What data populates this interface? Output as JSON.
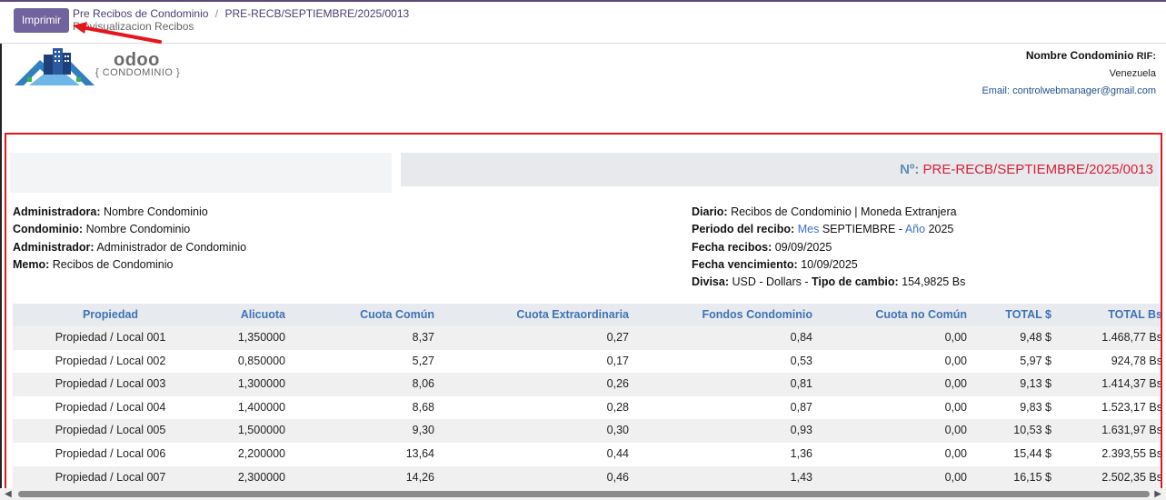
{
  "control_panel": {
    "print_label": "Imprimir",
    "breadcrumb_parent": "Pre Recibos de Condominio",
    "breadcrumb_separator": "/",
    "breadcrumb_current": "PRE-RECB/SEPTIEMBRE/2025/0013",
    "subtitle": "Previsualizacion Recibos"
  },
  "logo": {
    "brand": "odoo",
    "tagline": "{ CONDOMINIO }"
  },
  "company": {
    "name": "Nombre Condominio",
    "rif_label": "RIF:",
    "country": "Venezuela",
    "email": "Email: controlwebmanager@gmail.com"
  },
  "report": {
    "number_label": "Nº:",
    "number": "PRE-RECB/SEPTIEMBRE/2025/0013",
    "left_info": {
      "administradora_label": "Administradora:",
      "administradora": "Nombre Condominio",
      "condominio_label": "Condominio:",
      "condominio": "Nombre Condominio",
      "administrador_label": "Administrador:",
      "administrador": "Administrador de Condominio",
      "memo_label": "Memo:",
      "memo": "Recibos de Condominio"
    },
    "right_info": {
      "diario_label": "Diario:",
      "diario": "Recibos de Condominio | Moneda Extranjera",
      "periodo_label": "Periodo del recibo:",
      "mes_label": "Mes",
      "mes": "SEPTIEMBRE",
      "dash": "-",
      "anio_label": "Año",
      "anio": "2025",
      "fecha_recibos_label": "Fecha recibos:",
      "fecha_recibos": "09/09/2025",
      "fecha_venc_label": "Fecha vencimiento:",
      "fecha_venc": "10/09/2025",
      "divisa_label": "Divisa:",
      "divisa": "USD - Dollars -",
      "tipo_cambio_label": "Tipo de cambio:",
      "tipo_cambio": "154,9825 Bs"
    },
    "columns": [
      "Propiedad",
      "Alicuota",
      "Cuota Común",
      "Cuota Extraordinaria",
      "Fondos Condominio",
      "Cuota no Común",
      "TOTAL $",
      "TOTAL Bs"
    ],
    "rows": [
      [
        "Propiedad / Local 001",
        "1,350000",
        "8,37",
        "0,27",
        "0,84",
        "0,00",
        "9,48 $",
        "1.468,77 Bs"
      ],
      [
        "Propiedad / Local 002",
        "0,850000",
        "5,27",
        "0,17",
        "0,53",
        "0,00",
        "5,97 $",
        "924,78 Bs"
      ],
      [
        "Propiedad / Local 003",
        "1,300000",
        "8,06",
        "0,26",
        "0,81",
        "0,00",
        "9,13 $",
        "1.414,37 Bs"
      ],
      [
        "Propiedad / Local 004",
        "1,400000",
        "8,68",
        "0,28",
        "0,87",
        "0,00",
        "9,83 $",
        "1.523,17 Bs"
      ],
      [
        "Propiedad / Local 005",
        "1,500000",
        "9,30",
        "0,30",
        "0,93",
        "0,00",
        "10,53 $",
        "1.631,97 Bs"
      ],
      [
        "Propiedad / Local 006",
        "2,200000",
        "13,64",
        "0,44",
        "1,36",
        "0,00",
        "15,44 $",
        "2.393,55 Bs"
      ],
      [
        "Propiedad / Local 007",
        "2,300000",
        "14,26",
        "0,46",
        "1,43",
        "0,00",
        "16,15 $",
        "2.502,35 Bs"
      ]
    ]
  },
  "icons": {
    "arrow": "red-arrow-annotation-icon",
    "logo": "condo-buildings-logo-icon",
    "scroll_left": "scroll-left-arrow-icon",
    "scroll_right": "scroll-right-arrow-icon"
  },
  "colors": {
    "print_button": "#71639e",
    "report_border": "#e0161d",
    "number_text": "#d6213c",
    "header_text": "#3f73b5"
  }
}
